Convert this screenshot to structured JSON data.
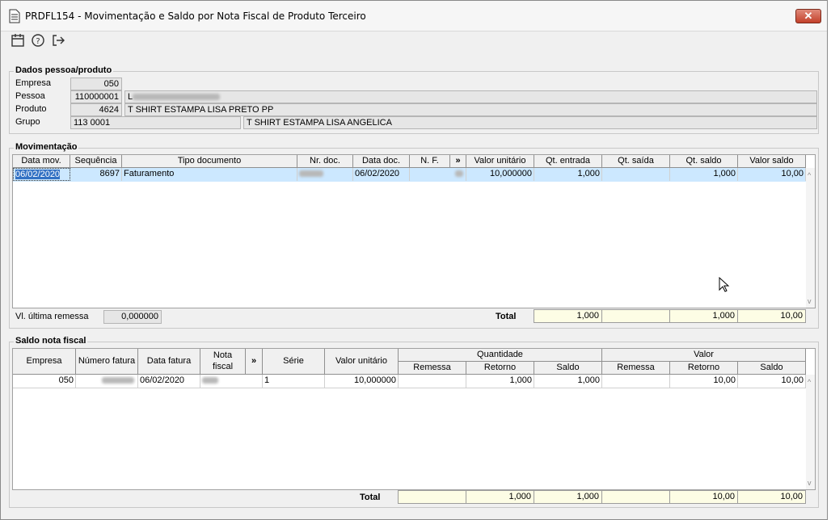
{
  "window": {
    "title": "PRDFL154 - Movimentação e Saldo por Nota Fiscal de Produto Terceiro",
    "close_label": "✕"
  },
  "toolbar": {
    "icons": [
      "calendar-icon",
      "help-icon",
      "exit-icon"
    ]
  },
  "dados": {
    "title": "Dados pessoa/produto",
    "empresa_label": "Empresa",
    "empresa_value": "050",
    "pessoa_label": "Pessoa",
    "pessoa_code": "110000001",
    "pessoa_name_prefix": "L",
    "produto_label": "Produto",
    "produto_code": "4624",
    "produto_name": "T SHIRT ESTAMPA LISA PRETO PP",
    "grupo_label": "Grupo",
    "grupo_code": "113 0001",
    "grupo_name": "T SHIRT ESTAMPA LISA ANGELICA"
  },
  "movimentacao": {
    "title": "Movimentação",
    "columns": [
      "Data mov.",
      "Sequência",
      "Tipo documento",
      "Nr. doc.",
      "Data doc.",
      "N. F.",
      "»",
      "Valor unitário",
      "Qt. entrada",
      "Qt. saída",
      "Qt. saldo",
      "Valor saldo"
    ],
    "rows": [
      {
        "data_mov": "06/02/2020",
        "sequencia": "8697",
        "tipo_documento": "Faturamento",
        "nr_doc": "",
        "data_doc": "06/02/2020",
        "nf": "",
        "valor_unitario": "10,000000",
        "qt_entrada": "1,000",
        "qt_saida": "",
        "qt_saldo": "1,000",
        "valor_saldo": "10,00"
      }
    ],
    "ultima_remessa_label": "Vl. última remessa",
    "ultima_remessa_value": "0,000000",
    "total_label": "Total",
    "totals": {
      "qt_entrada": "1,000",
      "qt_saida": "",
      "qt_saldo": "1,000",
      "valor_saldo": "10,00"
    }
  },
  "saldo": {
    "title": "Saldo nota fiscal",
    "columns": {
      "empresa": "Empresa",
      "numero_fatura": "Número fatura",
      "data_fatura": "Data fatura",
      "nota_fiscal_1": "Nota",
      "nota_fiscal_2": "fiscal",
      "more": "»",
      "serie": "Série",
      "valor_unitario": "Valor unitário",
      "quantidade": "Quantidade",
      "valor": "Valor",
      "remessa": "Remessa",
      "retorno": "Retorno",
      "saldo": "Saldo"
    },
    "rows": [
      {
        "empresa": "050",
        "numero_fatura": "",
        "data_fatura": "06/02/2020",
        "nota_fiscal": "",
        "serie": "1",
        "valor_unitario": "10,000000",
        "q_remessa": "",
        "q_retorno": "1,000",
        "q_saldo": "1,000",
        "v_remessa": "",
        "v_retorno": "10,00",
        "v_saldo": "10,00"
      }
    ],
    "total_label": "Total",
    "totals": {
      "q_remessa": "",
      "q_retorno": "1,000",
      "q_saldo": "1,000",
      "v_remessa": "",
      "v_retorno": "10,00",
      "v_saldo": "10,00"
    }
  },
  "colors": {
    "selected_row": "#cce8ff",
    "total_bg": "#fdfde5",
    "close_red": "#c3412b"
  }
}
